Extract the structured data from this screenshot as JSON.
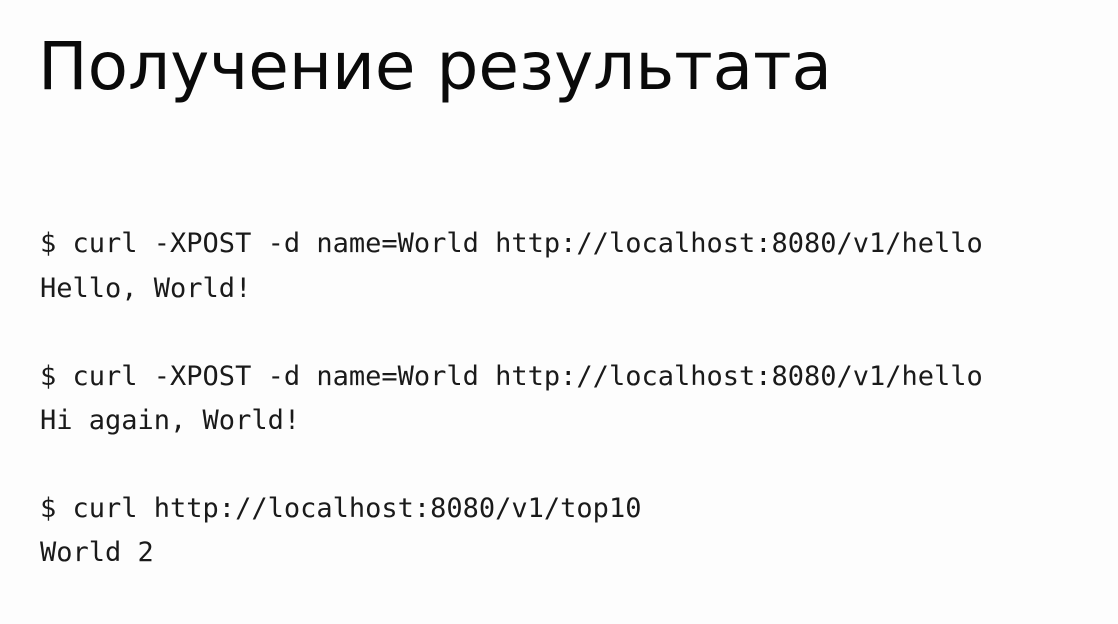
{
  "slide": {
    "title": "Получение результата",
    "blocks": [
      {
        "command": "$ curl -XPOST -d name=World http://localhost:8080/v1/hello",
        "output": "Hello, World!"
      },
      {
        "command": "$ curl -XPOST -d name=World http://localhost:8080/v1/hello",
        "output": "Hi again, World!"
      },
      {
        "command": "$ curl http://localhost:8080/v1/top10",
        "output": "World 2"
      }
    ]
  }
}
